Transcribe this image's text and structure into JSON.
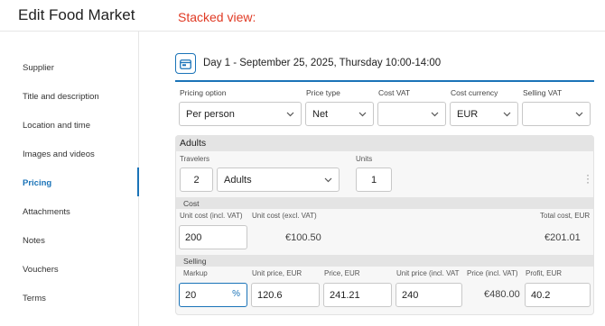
{
  "page": {
    "title": "Edit Food Market",
    "annotation": "Stacked view:"
  },
  "sidebar": {
    "items": [
      {
        "label": "Supplier"
      },
      {
        "label": "Title and description"
      },
      {
        "label": "Location and time"
      },
      {
        "label": "Images and videos"
      },
      {
        "label": "Pricing",
        "active": true
      },
      {
        "label": "Attachments"
      },
      {
        "label": "Notes"
      },
      {
        "label": "Vouchers"
      },
      {
        "label": "Terms"
      }
    ]
  },
  "day": {
    "title": "Day 1 - September 25, 2025, Thursday 10:00-14:00",
    "icon": "calendar-icon"
  },
  "pricing_row": {
    "pricing_option_label": "Pricing option",
    "pricing_option_value": "Per person",
    "price_type_label": "Price type",
    "price_type_value": "Net",
    "cost_vat_label": "Cost VAT",
    "cost_vat_value": "",
    "cost_currency_label": "Cost currency",
    "cost_currency_value": "EUR",
    "selling_vat_label": "Selling VAT",
    "selling_vat_value": ""
  },
  "adults": {
    "header": "Adults",
    "travelers_label": "Travelers",
    "travelers_count": "2",
    "traveler_type": "Adults",
    "units_label": "Units",
    "units_value": "1"
  },
  "cost": {
    "band": "Cost",
    "unit_cost_incl_label": "Unit cost (incl. VAT)",
    "unit_cost_incl_value": "200",
    "unit_cost_excl_label": "Unit cost (excl. VAT)",
    "unit_cost_excl_value": "€100.50",
    "total_cost_label": "Total cost, EUR",
    "total_cost_value": "€201.01"
  },
  "selling": {
    "band": "Selling",
    "markup_label": "Markup",
    "markup_value": "20",
    "markup_unit": "%",
    "unit_price_label": "Unit price, EUR",
    "unit_price_value": "120.6",
    "price_label": "Price, EUR",
    "price_value": "241.21",
    "unit_price_incl_label": "Unit price (incl. VAT",
    "unit_price_incl_value": "240",
    "price_incl_label": "Price (incl. VAT)",
    "price_incl_value": "€480.00",
    "profit_label": "Profit, EUR",
    "profit_value": "40.2"
  },
  "colors": {
    "accent": "#1a73b8",
    "annotation": "#e03a24"
  }
}
